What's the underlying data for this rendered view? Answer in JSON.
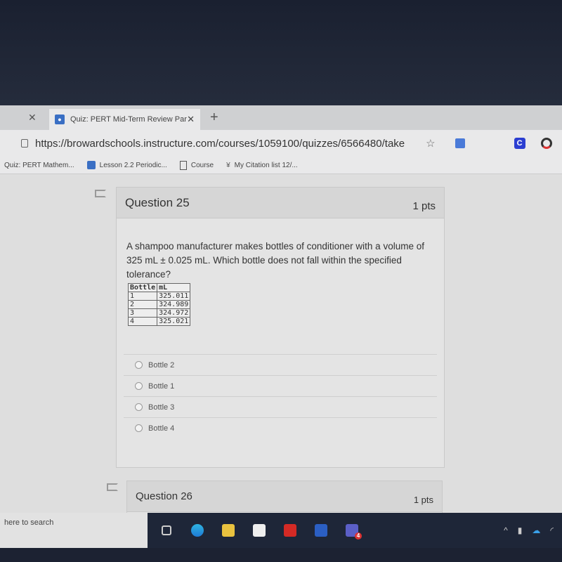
{
  "browser": {
    "tabs": [
      {
        "label": "Quiz: PERT Mid-Term Review Par",
        "active": true
      }
    ],
    "url": "https://browardschools.instructure.com/courses/1059100/quizzes/6566480/take",
    "extension_badge": "C",
    "bookmarks": [
      {
        "label": "Quiz: PERT Mathem..."
      },
      {
        "label": "Lesson 2.2 Periodic..."
      },
      {
        "label": "Course"
      },
      {
        "label": "My Citation list 12/..."
      }
    ]
  },
  "question": {
    "title": "Question 25",
    "points": "1 pts",
    "text": "A shampoo manufacturer makes bottles of conditioner with a volume of 325 mL ± 0.025 mL. Which bottle does not fall within the specified tolerance?",
    "table": {
      "headers": [
        "Bottle",
        "mL"
      ],
      "rows": [
        [
          "1",
          "325.011"
        ],
        [
          "2",
          "324.989"
        ],
        [
          "3",
          "324.972"
        ],
        [
          "4",
          "325.021"
        ]
      ]
    },
    "answers": [
      "Bottle 2",
      "Bottle 1",
      "Bottle 3",
      "Bottle 4"
    ]
  },
  "next_question": {
    "title": "Question 26",
    "points": "1 pts"
  },
  "taskbar": {
    "search_placeholder": "here to search",
    "apps": [
      "task-view",
      "edge",
      "file-explorer",
      "store",
      "acrobat",
      "word",
      "teams"
    ],
    "teams_badge": "4"
  }
}
